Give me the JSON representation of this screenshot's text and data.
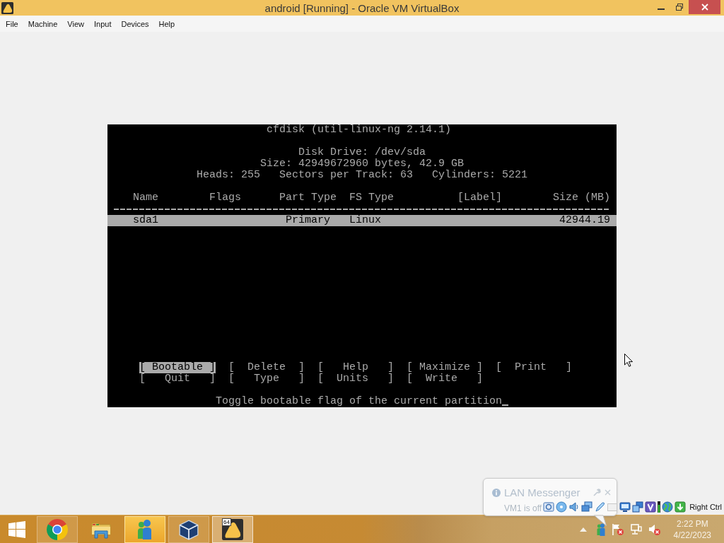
{
  "window": {
    "title": "android [Running] - Oracle VM VirtualBox"
  },
  "menu": [
    "File",
    "Machine",
    "View",
    "Input",
    "Devices",
    "Help"
  ],
  "terminal": {
    "title": "cfdisk (util-linux-ng 2.14.1)",
    "disk": [
      "Disk Drive: /dev/sda",
      "Size: 42949672960 bytes, 42.9 GB"
    ],
    "geometry": [
      "Heads: 255",
      "Sectors per Track: 63",
      "Cylinders: 5221"
    ],
    "table": {
      "columns": [
        "Name",
        "Flags",
        "Part Type",
        "FS Type",
        "[Label]",
        "Size (MB)"
      ],
      "rows": [
        {
          "name": "sda1",
          "part_type": "Primary",
          "fs_type": "Linux",
          "size": "42944.19",
          "selected": true
        }
      ]
    },
    "commands": [
      [
        {
          "label": "[ Bootable ]",
          "selected": true
        },
        {
          "label": "[  Delete  ]",
          "selected": false
        },
        {
          "label": "[   Help   ]",
          "selected": false
        },
        {
          "label": "[ Maximize ]",
          "selected": false
        },
        {
          "label": "[  Print   ]",
          "selected": false
        }
      ],
      [
        {
          "label": "[   Quit   ]",
          "selected": false
        },
        {
          "label": "[   Type   ]",
          "selected": false
        },
        {
          "label": "[  Units   ]",
          "selected": false
        },
        {
          "label": "[  Write   ]",
          "selected": false
        }
      ]
    ],
    "status": "Toggle bootable flag of the current partition"
  },
  "status_bar": {
    "host_key": "Right Ctrl"
  },
  "notification": {
    "title": "LAN Messenger",
    "message": "VM1 is off"
  },
  "taskbar": {
    "apps": [
      {
        "kind": "browser",
        "running": true,
        "active": false,
        "alert": false
      },
      {
        "kind": "files",
        "running": false,
        "active": false,
        "alert": false
      },
      {
        "kind": "messenger",
        "running": true,
        "active": false,
        "alert": true
      },
      {
        "kind": "vmmanager",
        "running": true,
        "active": false,
        "alert": false
      },
      {
        "kind": "vm",
        "running": true,
        "active": true,
        "alert": false,
        "badge": "64"
      }
    ],
    "clock": {
      "time": "2:22 PM",
      "date": "4/22/2023"
    }
  }
}
